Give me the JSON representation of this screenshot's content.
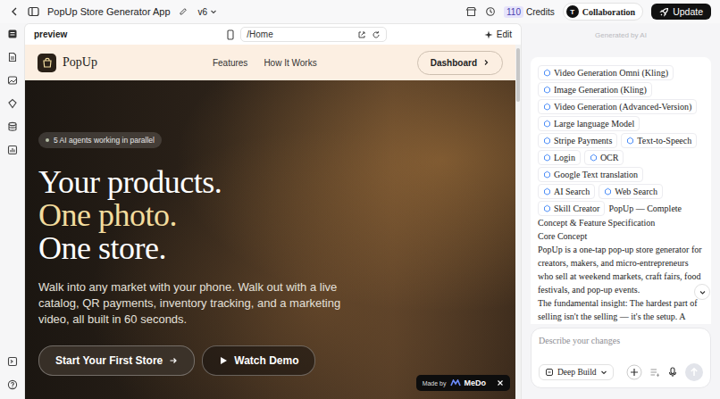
{
  "topbar": {
    "title": "PopUp Store Generator App",
    "version": "v6",
    "credits": "110",
    "credits_label": "Credits",
    "collaboration": {
      "avatar": "T",
      "label": "Collaboration"
    },
    "update": "Update"
  },
  "preview": {
    "label": "preview",
    "url": "/Home",
    "edit": "Edit"
  },
  "site": {
    "brand": "PopUp",
    "nav": [
      "Features",
      "How It Works"
    ],
    "dashboard": "Dashboard",
    "badge": "5 AI agents working in parallel",
    "headline": [
      {
        "text": "Your products.",
        "accent": false
      },
      {
        "text": "One photo.",
        "accent": true
      },
      {
        "text": "One store.",
        "accent": false
      }
    ],
    "subtitle": "Walk into any market with your phone. Walk out with a live catalog, QR payments, inventory tracking, and a marketing video, all built in 60 seconds.",
    "buttons": [
      {
        "label": "Start Your First Store",
        "kind": "arrow"
      },
      {
        "label": "Watch Demo",
        "kind": "play"
      }
    ]
  },
  "made_by": {
    "label": "Made by",
    "brand": "MeDo"
  },
  "chat": {
    "generated": "Generated by AI",
    "tags": [
      "Video Generation Omni (Kling)",
      "Image Generation (Kling)",
      "Video Generation (Advanced-Version)",
      "Large language Model",
      "Stripe Payments",
      "Text-to-Speech",
      "Login",
      "OCR",
      "Google Text translation",
      "AI Search",
      "Web Search",
      "Skill Creator"
    ],
    "title": "PopUp — Complete",
    "lines": [
      "Concept & Feature Specification",
      "Core Concept",
      "PopUp is a one-tap pop-up store generator for creators, makers, and micro-entrepreneurs who sell at weekend markets, craft fairs, food festivals, and pop-up events.",
      "The fundamental insight: The hardest part of selling isn't the selling — it's the setup. A"
    ],
    "input": {
      "placeholder": "Describe your changes",
      "mode": "Deep Build"
    }
  }
}
